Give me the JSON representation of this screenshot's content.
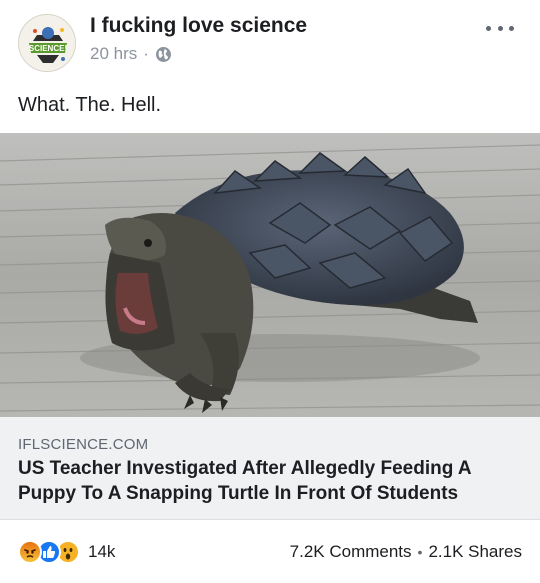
{
  "post": {
    "page_name": "I fucking love science",
    "time": "20 hrs",
    "separator": "·",
    "privacy_icon": "globe-icon",
    "text": "What. The. Hell.",
    "avatar_text": "SCIENCE!"
  },
  "link": {
    "domain": "IFLSCIENCE.COM",
    "title": "US Teacher Investigated After Allegedly Feeding A Puppy To A Snapping Turtle In Front Of Students",
    "image_subject": "snapping-turtle-photo"
  },
  "footer": {
    "reaction_icons": [
      "angry-icon",
      "like-icon",
      "wow-icon"
    ],
    "reaction_count": "14k",
    "comments": "7.2K Comments",
    "separator": "•",
    "shares": "2.1K Shares"
  },
  "colors": {
    "text": "#1c1e21",
    "meta": "#8d949e",
    "card_bg": "#eff1f3",
    "like_blue": "#1877f2"
  }
}
